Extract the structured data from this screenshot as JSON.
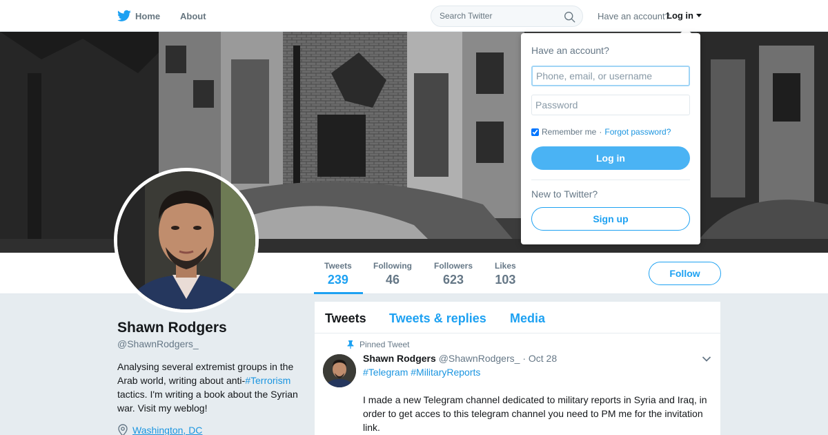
{
  "nav": {
    "home_label": "Home",
    "about_label": "About",
    "search_placeholder": "Search Twitter",
    "have_account": "Have an account?",
    "login_label": "Log in"
  },
  "profile": {
    "name": "Shawn Rodgers",
    "handle": "@ShawnRodgers_",
    "bio_part1": "Analysing several extremist groups in the Arab world, writing about anti-",
    "bio_hashtag": "#Terrorism",
    "bio_part2": " tactics. I'm writing a book about the Syrian war. Visit my weblog!",
    "location": "Washington, DC"
  },
  "stats": {
    "tweets_label": "Tweets",
    "tweets_value": "239",
    "following_label": "Following",
    "following_value": "46",
    "followers_label": "Followers",
    "followers_value": "623",
    "likes_label": "Likes",
    "likes_value": "103"
  },
  "follow_label": "Follow",
  "timeline": {
    "tabs": [
      "Tweets",
      "Tweets & replies",
      "Media"
    ],
    "pinned_label": "Pinned Tweet",
    "tweet": {
      "name": "Shawn Rodgers",
      "handle": "@ShawnRodgers_",
      "date": "· Oct 28",
      "hashtags": "#Telegram #MilitaryReports",
      "text": "I made a new Telegram channel dedicated to military reports in Syria and Iraq, in order to get acces to this telegram channel you need to PM me for the invitation link."
    }
  },
  "login_dropdown": {
    "title": "Have an account?",
    "username_placeholder": "Phone, email, or username",
    "password_placeholder": "Password",
    "remember_label": "Remember me",
    "separator": "·",
    "forgot_label": "Forgot password?",
    "login_button": "Log in",
    "new_label": "New to Twitter?",
    "signup_button": "Sign up"
  },
  "colors": {
    "accent": "#1da1f2",
    "link": "#1b95e0",
    "login_button": "#4ab3f4",
    "background": "#e6ecf0"
  }
}
